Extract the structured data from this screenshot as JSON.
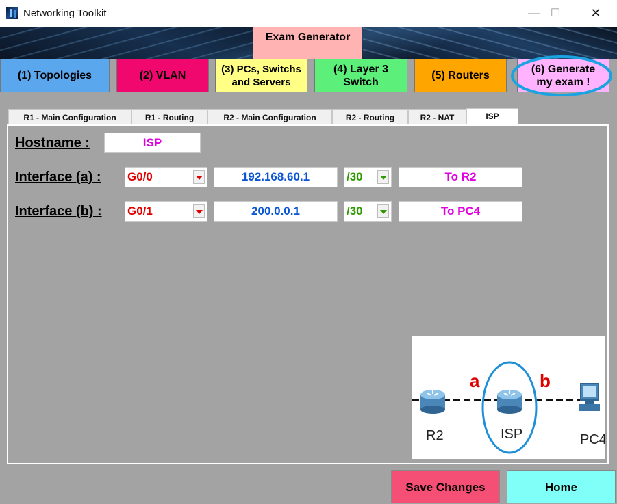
{
  "window": {
    "title": "Networking Toolkit",
    "minimize": "—",
    "maximize": "☐",
    "close": "✕"
  },
  "header": {
    "exam_generator": "Exam Generator"
  },
  "nav": [
    {
      "label": "(1) Topologies",
      "color": "#5aa7ee"
    },
    {
      "label": "(2) VLAN",
      "color": "#f0086e"
    },
    {
      "label": "(3) PCs, Switchs and Servers",
      "color": "#ffff85"
    },
    {
      "label": "(4) Layer 3 Switch",
      "color": "#5cf07a"
    },
    {
      "label": "(5) Routers",
      "color": "#ffa500"
    },
    {
      "label": "(6) Generate my exam !",
      "color": "#ffb3ff",
      "highlight": "#1aa3e0"
    }
  ],
  "tabs": [
    {
      "label": "R1 - Main Configuration"
    },
    {
      "label": "R1 - Routing"
    },
    {
      "label": "R2 - Main Configuration"
    },
    {
      "label": "R2 - Routing"
    },
    {
      "label": "R2 - NAT"
    },
    {
      "label": "ISP",
      "active": true
    }
  ],
  "form": {
    "hostname_label": "Hostname :",
    "hostname_value": "ISP",
    "interface_a": {
      "label": "Interface (a) :",
      "port": "G0/0",
      "ip": "192.168.60.1",
      "mask": "/30",
      "description": "To R2"
    },
    "interface_b": {
      "label": "Interface (b) :",
      "port": "G0/1",
      "ip": "200.0.0.1",
      "mask": "/30",
      "description": "To PC4"
    }
  },
  "diagram": {
    "link_a": "a",
    "link_b": "b",
    "node_r2": "R2",
    "node_isp": "ISP",
    "node_pc4": "PC4"
  },
  "footer": {
    "save": "Save Changes",
    "home": "Home",
    "save_color": "#f54f75",
    "home_color": "#7ffff7"
  }
}
